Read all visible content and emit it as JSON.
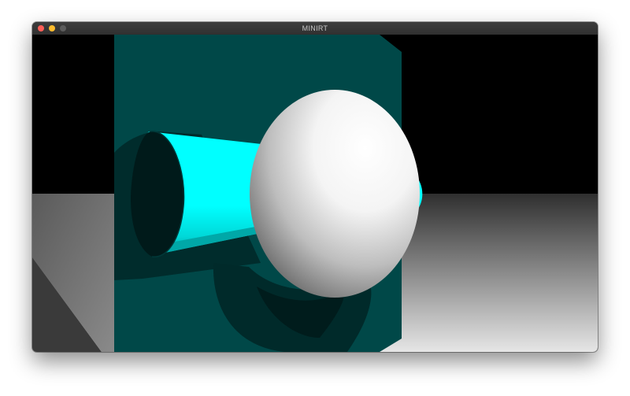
{
  "window": {
    "title": "MINIRT"
  },
  "colors": {
    "background": "#000000",
    "wall": "#004848",
    "cylinder": "#00ffff",
    "sphere": "#ffffff",
    "floor_far": "#2f2f2f",
    "floor_near": "#e3e3e3",
    "traffic_close": "#ff5f57",
    "traffic_minimize": "#febc2e",
    "traffic_zoom": "#5c5c5c"
  },
  "icons": [
    "close-icon",
    "minimize-icon",
    "zoom-icon"
  ]
}
